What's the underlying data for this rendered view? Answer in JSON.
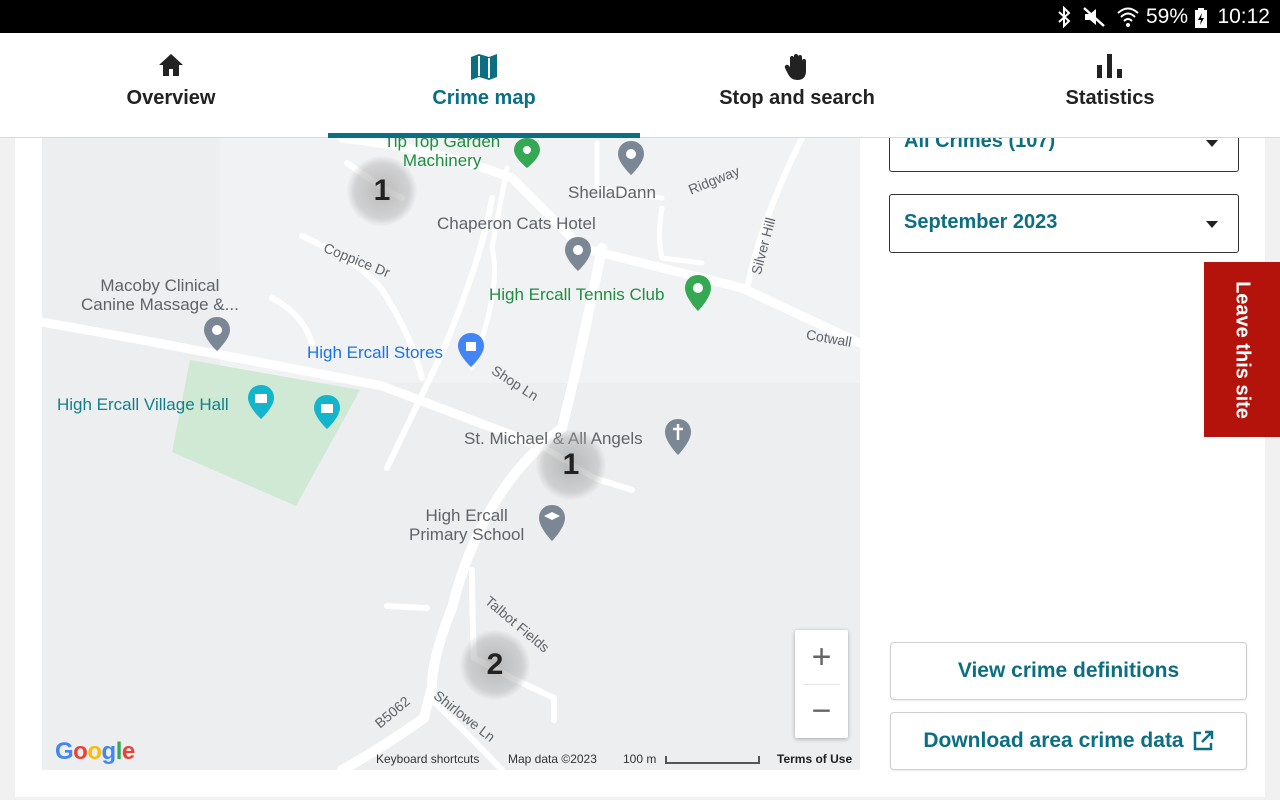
{
  "status_bar": {
    "battery_percent": "59%",
    "time": "10:12",
    "icons": [
      "bluetooth-icon",
      "mute-icon",
      "wifi-icon",
      "battery-charging-icon"
    ]
  },
  "nav": {
    "tabs": [
      {
        "label": "Overview",
        "icon": "home-icon",
        "active": false
      },
      {
        "label": "Crime map",
        "icon": "map-icon",
        "active": true
      },
      {
        "label": "Stop and search",
        "icon": "hand-icon",
        "active": false
      },
      {
        "label": "Statistics",
        "icon": "bar-chart-icon",
        "active": false
      }
    ]
  },
  "colors": {
    "accent": "#0b6e83",
    "leave_site": "#b3130b"
  },
  "map": {
    "places": {
      "tip_top": "Tip Top Garden\nMachinery",
      "sheila": "SheilaDann",
      "chaperon": "Chaperon Cats Hotel",
      "macoby": "Macoby Clinical\nCanine Massage &...",
      "tennis": "High Ercall Tennis Club",
      "stores": "High Ercall Stores",
      "village_hall": "High Ercall Village Hall",
      "church": "St. Michael & All Angels",
      "school": "High Ercall\nPrimary School"
    },
    "roads": {
      "coppice": "Coppice Dr",
      "ridgway": "Ridgway",
      "silver_hill": "Silver Hill",
      "cotwall": "Cotwall",
      "shop_ln": "Shop Ln",
      "talbot": "Talbot Fields",
      "b5062": "B5062",
      "shirlowe": "Shirlowe Ln"
    },
    "clusters": [
      "1",
      "1",
      "2"
    ],
    "zoom_in": "+",
    "zoom_out": "−",
    "logo": "Google",
    "keyboard_shortcuts": "Keyboard shortcuts",
    "map_data": "Map data ©2023",
    "scale": "100 m",
    "terms": "Terms of Use"
  },
  "filters": {
    "crime_type": "All Crimes (107)",
    "month": "September 2023"
  },
  "leave_site": "Leave this site",
  "buttons": {
    "definitions": "View crime definitions",
    "download": "Download area crime data"
  }
}
